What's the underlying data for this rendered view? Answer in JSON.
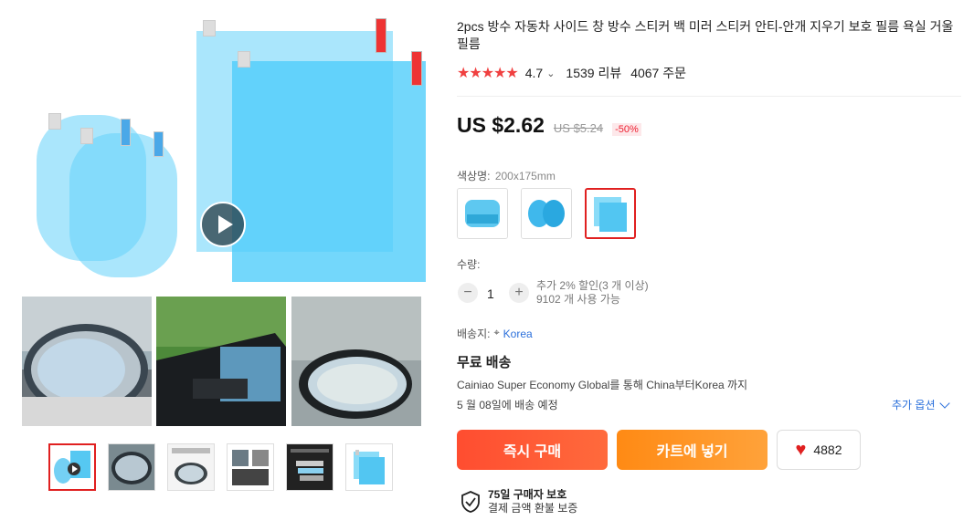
{
  "product": {
    "title": "2pcs 방수 자동차 사이드 창 방수 스티커 백 미러 스티커 안티-안개 지우기 보호 필름 욕실 거울 필름",
    "rating_value": "4.7",
    "rating_chevron": "⌄",
    "reviews": "1539 리뷰",
    "orders": "4067 주문",
    "stars": 5
  },
  "price": {
    "current": "US $2.62",
    "original": "US $5.24",
    "discount": "-50%"
  },
  "variant": {
    "label": "색상명:",
    "selected": "200x175mm"
  },
  "quantity": {
    "label": "수량:",
    "minus": "−",
    "value": "1",
    "plus": "+",
    "discount_note": "추가 2% 할인(3 개 이상)",
    "stock_note": "9102 개 사용 가능"
  },
  "shipping": {
    "label": "배송지:",
    "destination": "Korea",
    "free_label": "무료 배송",
    "method": "Cainiao Super Economy Global를 통해 China부터Korea 까지",
    "eta": "5 월 08일에 배송 예정",
    "more_options": "추가 옵션"
  },
  "actions": {
    "buy_now": "즉시 구매",
    "add_to_cart": "카트에 넣기",
    "wish_count": "4882"
  },
  "protection": {
    "title": "75일 구매자 보호",
    "subtitle": "결제 금액 환불 보증"
  },
  "colors": {
    "accent": "#e02020",
    "buy_gradient": "#ff5a33",
    "cart_orange": "#ff8a1a",
    "film": "#64d2fa"
  }
}
